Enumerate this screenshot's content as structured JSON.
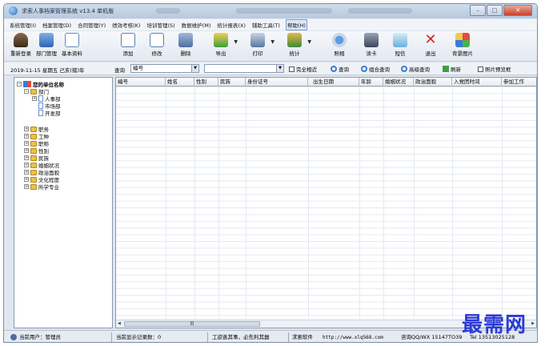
{
  "app": {
    "title": "求索人事档案管理系统 v13.4 单机版"
  },
  "menubar": {
    "items": [
      {
        "label": "系统管理(I)"
      },
      {
        "label": "档案管理(D)"
      },
      {
        "label": "合同管理(Y)"
      },
      {
        "label": "绩效考核(K)"
      },
      {
        "label": "培训管理(S)"
      },
      {
        "label": "数据维护(M)"
      },
      {
        "label": "统计报表(X)"
      },
      {
        "label": "辅助工具(T)"
      },
      {
        "label": "帮助(H)"
      }
    ]
  },
  "toolbar": {
    "relogin": "重新登录",
    "dept": "部门管理",
    "basic": "基本资料",
    "add": "添加",
    "edit": "修改",
    "delete": "删除",
    "export": "导出",
    "print": "打印",
    "stats": "统计",
    "photo": "照相",
    "readcard": "读卡",
    "sms": "短信",
    "exit": "退出",
    "bg": "背景图片"
  },
  "filterbar": {
    "date": "2019-11-15 星期五 己亥(猪)年",
    "query_label": "查询",
    "field_value": "编号",
    "value_value": "",
    "fuzzy_label": "完全相近",
    "query": "查询",
    "combo_query": "组合查询",
    "adv_query": "高级查询",
    "refresh": "刷新",
    "photo_preview": "照片预览框"
  },
  "tree": {
    "root": "您的单位名称",
    "dept": "部门",
    "children": [
      "人事部",
      "市场部",
      "开发部"
    ],
    "groups": [
      "职务",
      "工种",
      "职称",
      "性别",
      "民族",
      "婚姻状况",
      "政治面貌",
      "文化程度",
      "所学专业"
    ]
  },
  "grid": {
    "columns": [
      "编号",
      "姓名",
      "性别",
      "民族",
      "身份证号",
      "出生日期",
      "年龄",
      "婚姻状况",
      "政治面貌",
      "入党团时间",
      "参加工作"
    ]
  },
  "statusbar": {
    "user": "当前用户：管理员",
    "count": "当前显示记录数：0",
    "motto": "工欲善其事，必先利其器",
    "soft": "求索软件",
    "url": "http://www.xlq568.com",
    "contact": "咨询QQ/WX 15147TO39",
    "tel": "Tel 13513025128"
  },
  "watermark": "最需网"
}
